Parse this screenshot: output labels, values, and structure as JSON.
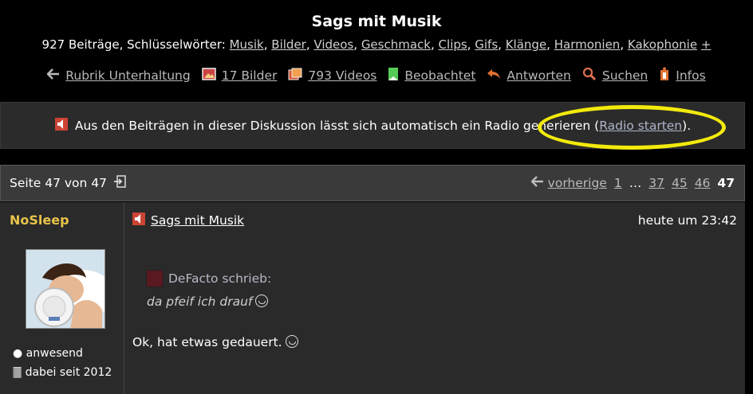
{
  "header": {
    "title": "Sags mit Musik",
    "meta_prefix": "927 Beiträge, Schlüsselwörter:",
    "keywords": [
      "Musik",
      "Bilder",
      "Videos",
      "Geschmack",
      "Clips",
      "Gifs",
      "Klänge",
      "Harmonien",
      "Kakophonie"
    ],
    "more": "+"
  },
  "nav": [
    {
      "label": "Rubrik Unterhaltung",
      "icon": "arrow-left-icon"
    },
    {
      "label": "17 Bilder",
      "icon": "image-icon"
    },
    {
      "label": "793 Videos",
      "icon": "video-icon"
    },
    {
      "label": "Beobachtet",
      "icon": "bookmark-icon"
    },
    {
      "label": "Antworten",
      "icon": "reply-icon"
    },
    {
      "label": "Suchen",
      "icon": "search-icon"
    },
    {
      "label": "Infos",
      "icon": "info-icon"
    }
  ],
  "radio": {
    "text": "Aus den Beiträgen in dieser Diskussion lässt sich automatisch ein Radio generieren (",
    "link": "Radio starten",
    "suffix": ").",
    "highlight_color": "#f2ea0c"
  },
  "pager": {
    "page_text": "Seite 47 von 47",
    "prev": "vorherige",
    "pages": [
      "1",
      "…",
      "37",
      "45",
      "46"
    ],
    "current": "47"
  },
  "post": {
    "author": "NoSleep",
    "author_color": "#e8c44a",
    "status": "anwesend",
    "since": "dabei seit 2012",
    "title": "Sags mit Musik",
    "time": "heute um 23:42",
    "quote_author": "DeFacto schrieb:",
    "quote_text": "da pfeif ich drauf",
    "text": "Ok, hat etwas gedauert."
  }
}
